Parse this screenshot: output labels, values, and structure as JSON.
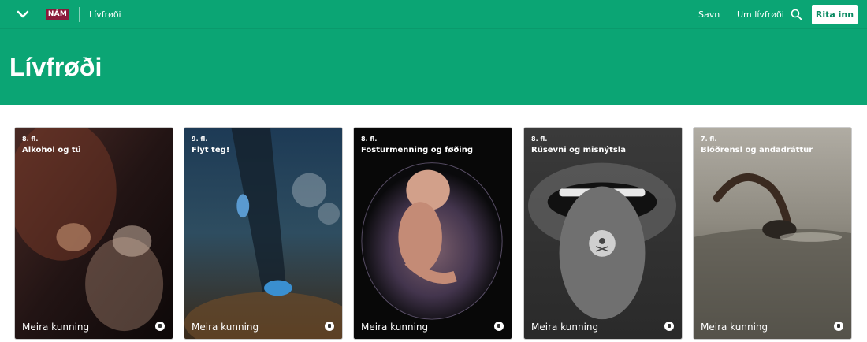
{
  "header": {
    "logo_text": "NÁM",
    "breadcrumb": "Lívfrøði",
    "nav": [
      "Savn",
      "Um lívfrøði"
    ],
    "login_label": "Rita inn"
  },
  "hero": {
    "title": "Lívfrøði"
  },
  "cards": [
    {
      "grade": "8. fl.",
      "title": "Alkohol og tú",
      "more": "Meira kunning"
    },
    {
      "grade": "9. fl.",
      "title": "Flyt teg!",
      "more": "Meira kunning"
    },
    {
      "grade": "8. fl.",
      "title": "Fosturmenning og føðing",
      "more": "Meira kunning"
    },
    {
      "grade": "8. fl.",
      "title": "Rúsevni og misnýtsla",
      "more": "Meira kunning"
    },
    {
      "grade": "7. fl.",
      "title": "Blóðrensl og andadráttur",
      "more": "Meira kunning"
    }
  ],
  "colors": {
    "brand": "#0ba574",
    "logo": "#8b1a3b"
  },
  "icons": [
    "chevron-down-icon",
    "search-icon",
    "lock-icon"
  ]
}
